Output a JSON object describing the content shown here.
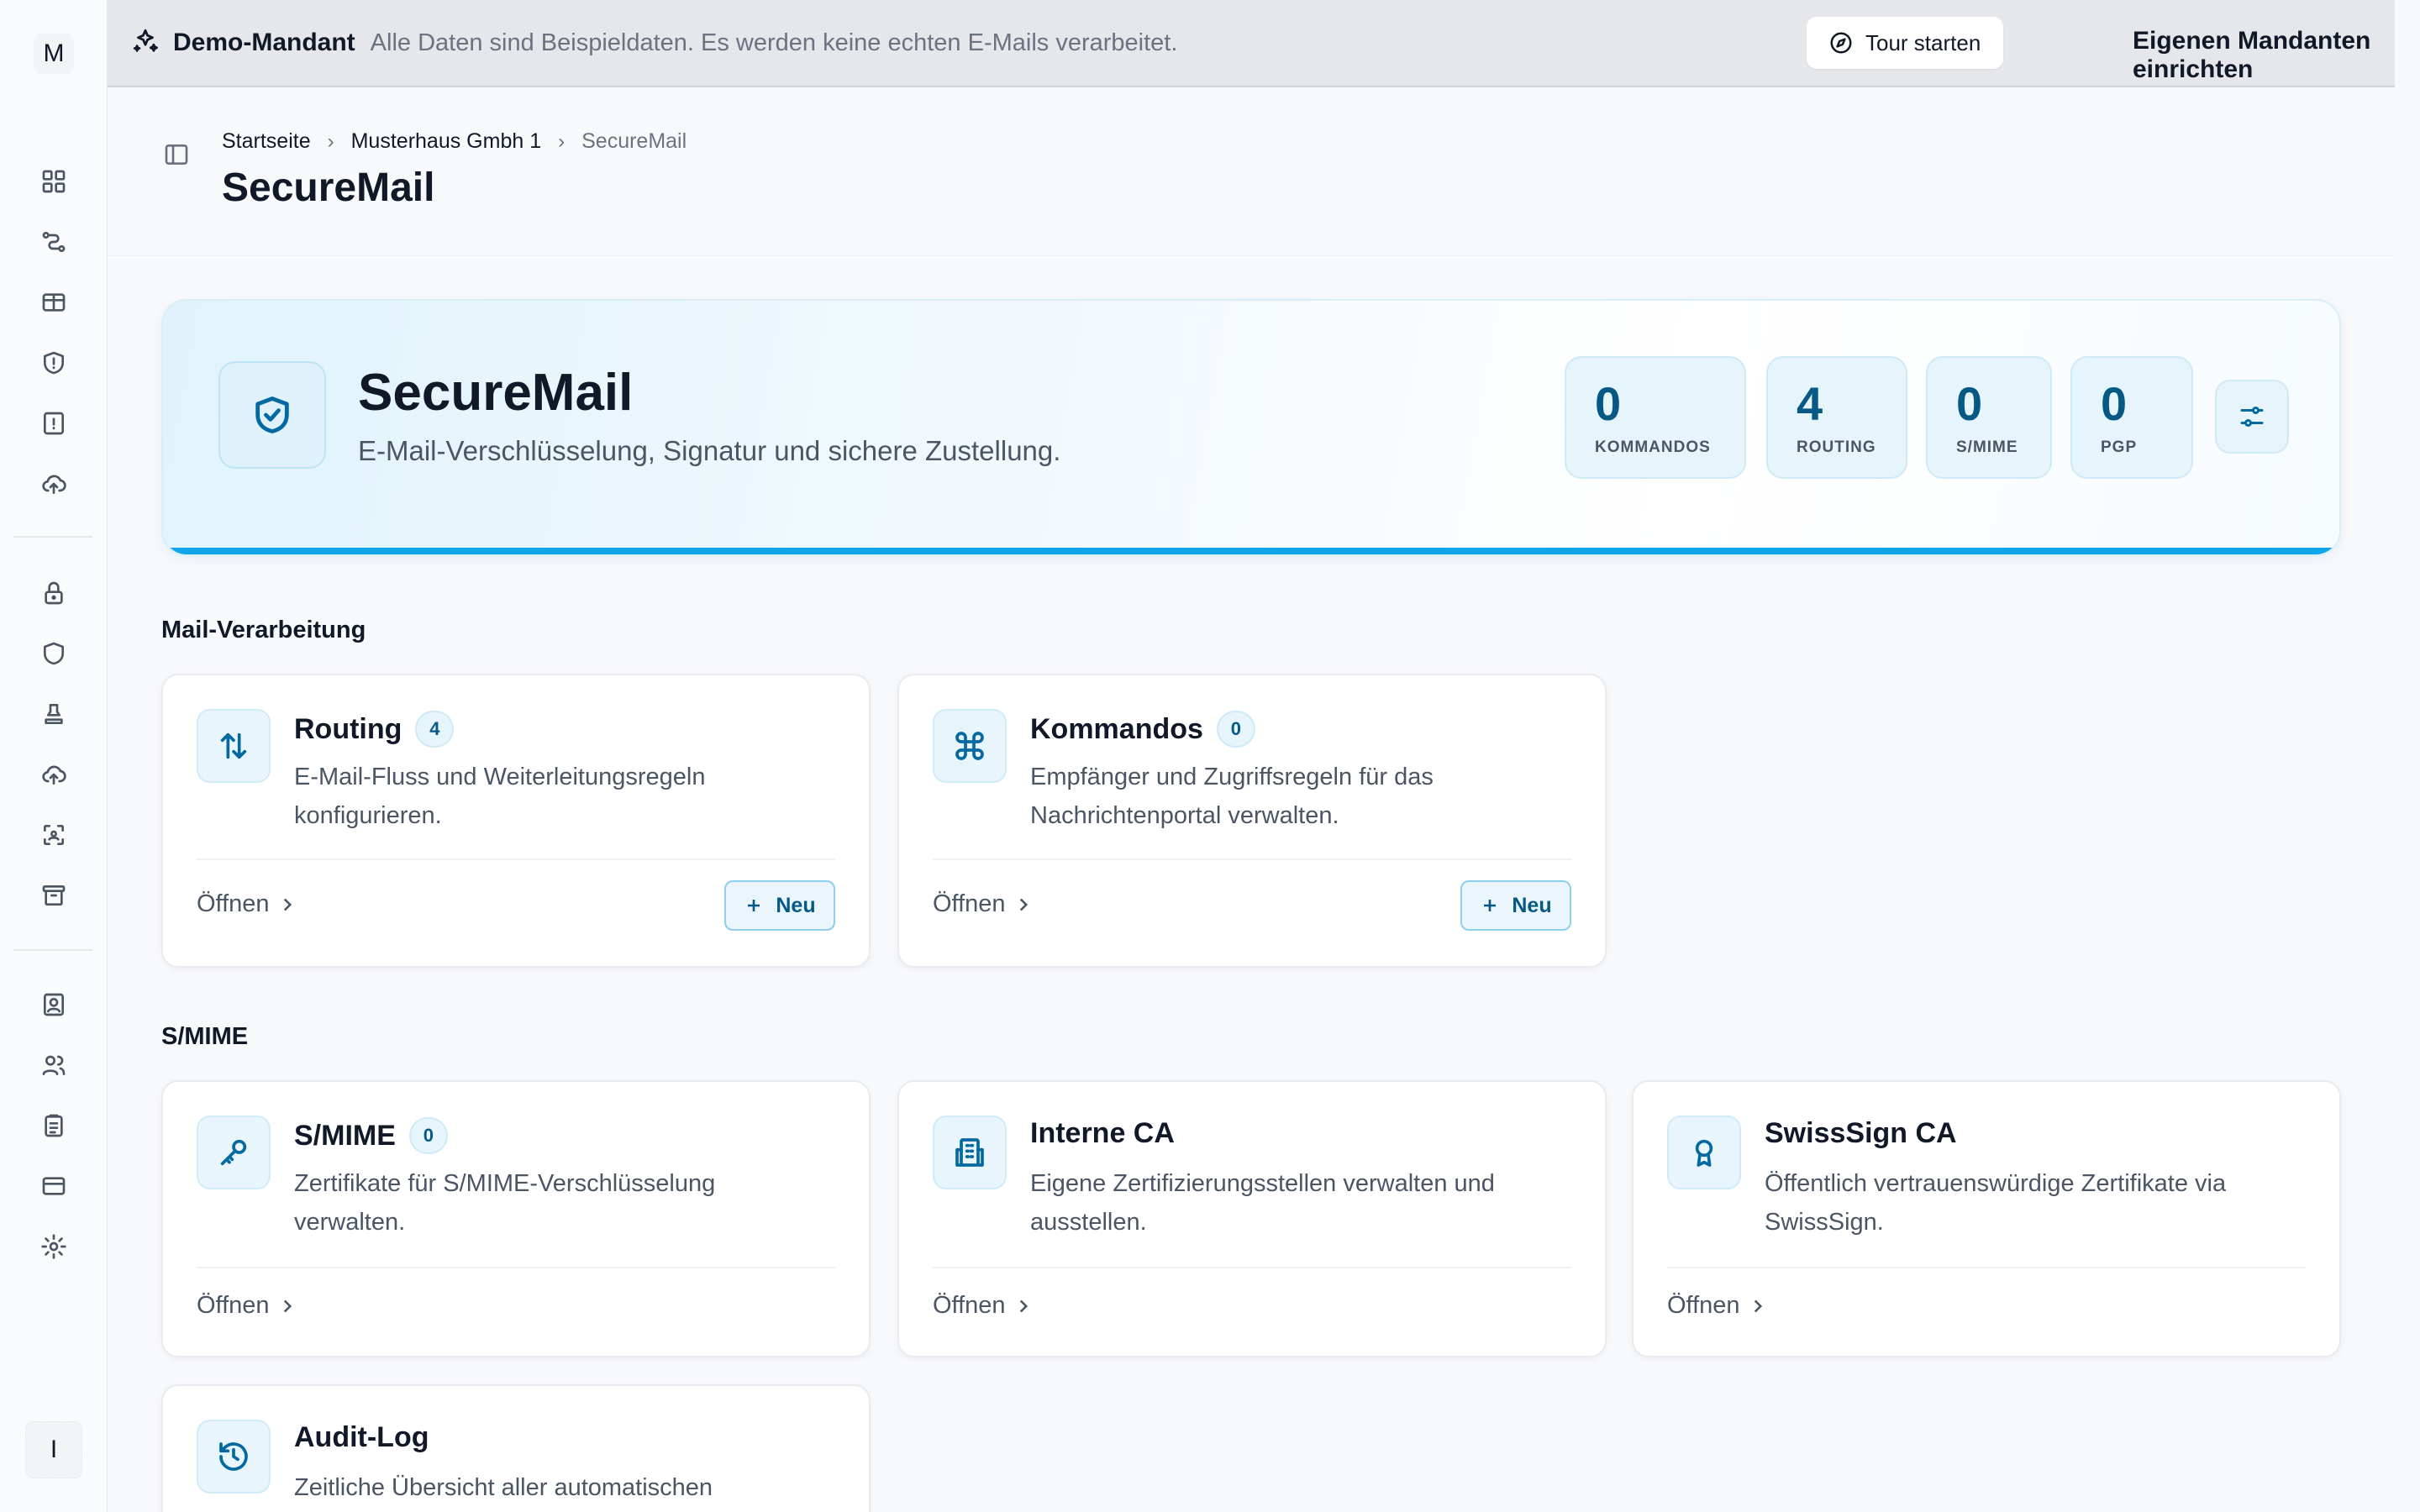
{
  "sidebar": {
    "logo_letter": "M",
    "user_initial": "I",
    "icons": [
      "dashboard-icon",
      "workflow-icon",
      "ticket-icon",
      "shield-alert-icon",
      "alert-file-icon",
      "cloud-upload-icon",
      "lock-icon",
      "shield-icon",
      "stamp-icon",
      "cloud-sync-icon",
      "scan-icon",
      "archive-icon",
      "contact-card-icon",
      "users-icon",
      "clipboard-icon",
      "credit-card-icon",
      "settings-icon"
    ]
  },
  "banner": {
    "title": "Demo-Mandant",
    "text": "Alle Daten sind Beispieldaten. Es werden keine echten E-Mails verarbeitet.",
    "tour_button": "Tour starten",
    "own_tenant_link": "Eigenen Mandanten einrichten"
  },
  "breadcrumb": {
    "items": [
      "Startseite",
      "Musterhaus Gmbh 1",
      "SecureMail"
    ]
  },
  "page_title": "SecureMail",
  "hero": {
    "title": "SecureMail",
    "subtitle": "E-Mail-Verschlüsselung, Signatur und sichere Zustellung.",
    "stats": [
      {
        "value": "0",
        "label": "KOMMANDOS"
      },
      {
        "value": "4",
        "label": "ROUTING"
      },
      {
        "value": "0",
        "label": "S/MIME"
      },
      {
        "value": "0",
        "label": "PGP"
      }
    ]
  },
  "sections": {
    "mail_processing": "Mail-Verarbeitung",
    "smime": "S/MIME"
  },
  "cards": {
    "routing": {
      "title": "Routing",
      "count": "4",
      "desc": "E-Mail-Fluss und Weiterleitungsregeln konfigurieren.",
      "open": "Öffnen",
      "new": "Neu"
    },
    "kommandos": {
      "title": "Kommandos",
      "count": "0",
      "desc": "Empfänger und Zugriffsregeln für das Nachrichtenportal verwalten.",
      "open": "Öffnen",
      "new": "Neu"
    },
    "smime": {
      "title": "S/MIME",
      "count": "0",
      "desc": "Zertifikate für S/MIME-Verschlüsselung verwalten.",
      "open": "Öffnen"
    },
    "interne_ca": {
      "title": "Interne CA",
      "desc": "Eigene Zertifizierungsstellen verwalten und ausstellen.",
      "open": "Öffnen"
    },
    "swisssign": {
      "title": "SwissSign CA",
      "desc": "Öffentlich vertrauenswürdige Zertifikate via SwissSign.",
      "open": "Öffnen"
    },
    "audit": {
      "title": "Audit-Log",
      "desc": "Zeitliche Übersicht aller automatischen"
    }
  },
  "colors": {
    "accent": "#0ea5e9",
    "accent_dark": "#075985"
  }
}
